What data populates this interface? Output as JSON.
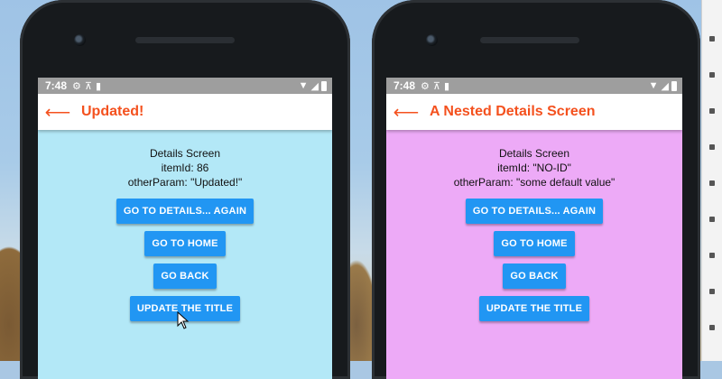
{
  "left_phone": {
    "status": {
      "time": "7:48"
    },
    "appbar": {
      "back_icon": "arrow-left-icon",
      "title": "Updated!"
    },
    "content": {
      "lines": [
        "Details Screen",
        "itemId: 86",
        "otherParam: \"Updated!\""
      ],
      "buttons": [
        "GO TO DETAILS... AGAIN",
        "GO TO HOME",
        "GO BACK",
        "UPDATE THE TITLE"
      ]
    },
    "background_color": "#b3e8f7"
  },
  "right_phone": {
    "status": {
      "time": "7:48"
    },
    "appbar": {
      "back_icon": "arrow-left-icon",
      "title": "A Nested Details Screen"
    },
    "content": {
      "lines": [
        "Details Screen",
        "itemId: \"NO-ID\"",
        "otherParam: \"some default value\""
      ],
      "buttons": [
        "GO TO DETAILS... AGAIN",
        "GO TO HOME",
        "GO BACK",
        "UPDATE THE TITLE"
      ]
    },
    "background_color": "#edaaf7"
  },
  "colors": {
    "accent": "#f4511e",
    "button": "#2196f3",
    "statusbar": "#9e9e9e"
  }
}
